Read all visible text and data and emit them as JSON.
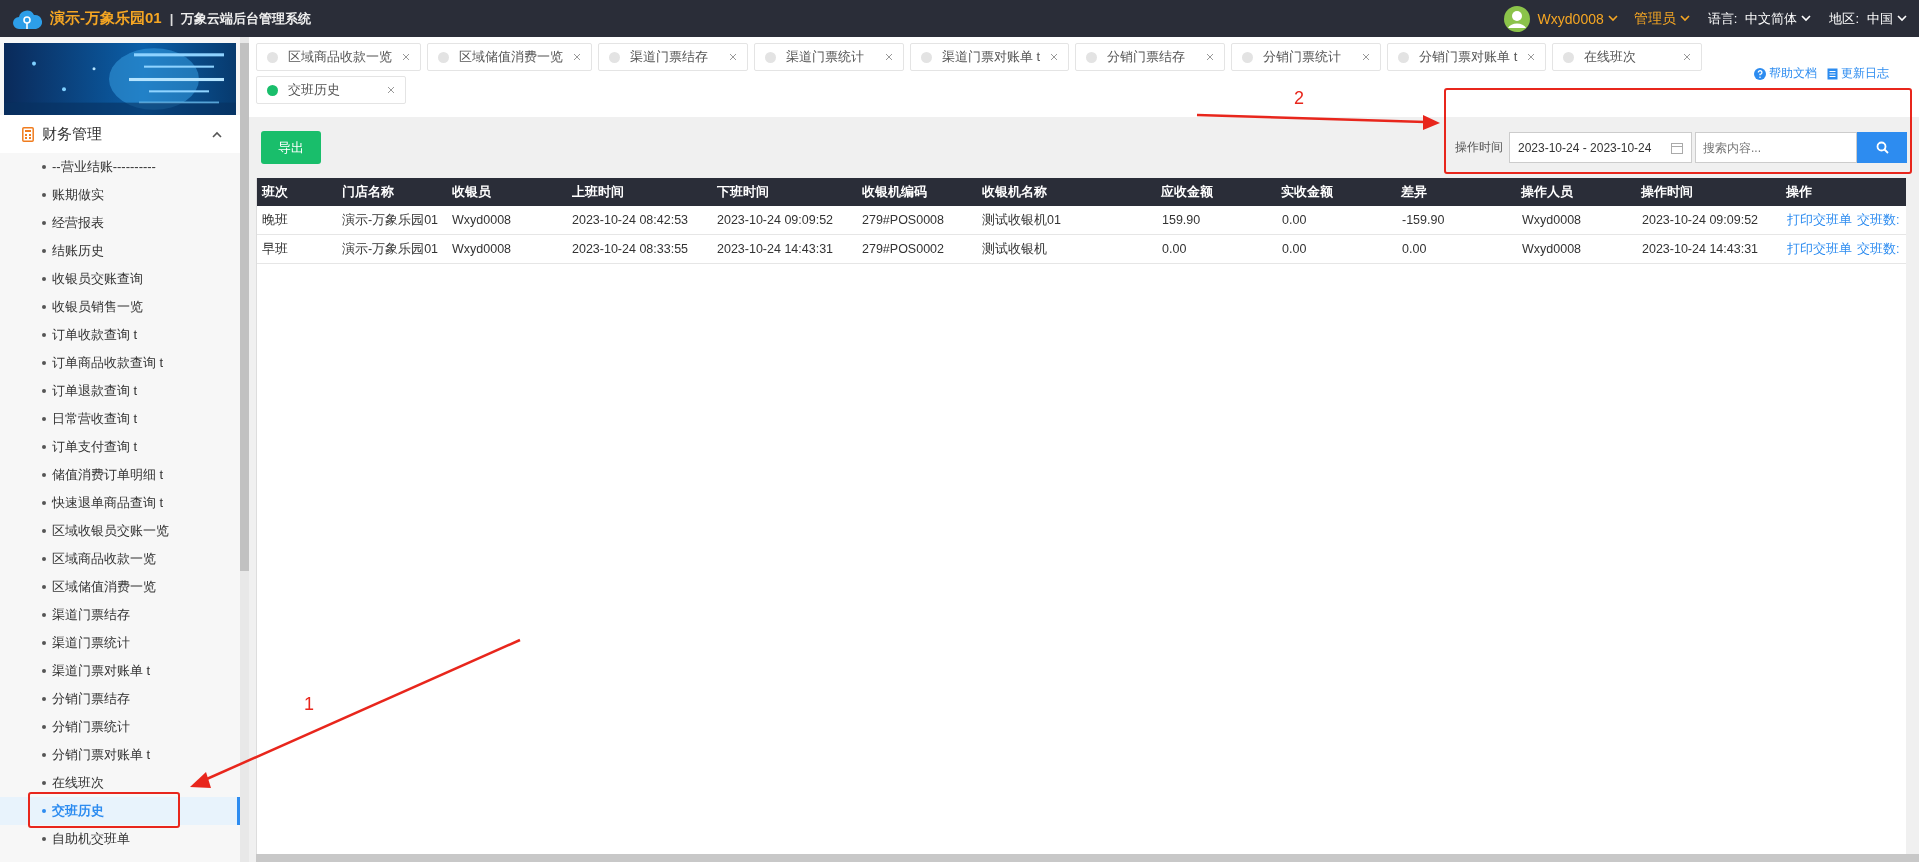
{
  "header": {
    "brand": "演示-万象乐园01",
    "separator": "|",
    "system": "万象云端后台管理系统",
    "user": "Wxyd0008",
    "role": "管理员",
    "language_label": "语言:",
    "language": "中文简体",
    "region_label": "地区:",
    "region": "中国"
  },
  "sidebar": {
    "group": {
      "label": "财务管理",
      "expanded": true
    },
    "items": [
      {
        "label": "--营业结账----------",
        "selected": false
      },
      {
        "label": "账期做实",
        "selected": false
      },
      {
        "label": "经营报表",
        "selected": false
      },
      {
        "label": "结账历史",
        "selected": false
      },
      {
        "label": "收银员交账查询",
        "selected": false
      },
      {
        "label": "收银员销售一览",
        "selected": false
      },
      {
        "label": "订单收款查询 t",
        "selected": false
      },
      {
        "label": "订单商品收款查询 t",
        "selected": false
      },
      {
        "label": "订单退款查询 t",
        "selected": false
      },
      {
        "label": "日常营收查询 t",
        "selected": false
      },
      {
        "label": "订单支付查询 t",
        "selected": false
      },
      {
        "label": "储值消费订单明细 t",
        "selected": false
      },
      {
        "label": "快速退单商品查询 t",
        "selected": false
      },
      {
        "label": "区域收银员交账一览",
        "selected": false
      },
      {
        "label": "区域商品收款一览",
        "selected": false
      },
      {
        "label": "区域储值消费一览",
        "selected": false
      },
      {
        "label": "渠道门票结存",
        "selected": false
      },
      {
        "label": "渠道门票统计",
        "selected": false
      },
      {
        "label": "渠道门票对账单 t",
        "selected": false
      },
      {
        "label": "分销门票结存",
        "selected": false
      },
      {
        "label": "分销门票统计",
        "selected": false
      },
      {
        "label": "分销门票对账单 t",
        "selected": false
      },
      {
        "label": "在线班次",
        "selected": false
      },
      {
        "label": "交班历史",
        "selected": true
      },
      {
        "label": "自助机交班单",
        "selected": false
      }
    ]
  },
  "tabs": [
    {
      "label": "区域商品收款一览",
      "selected": false
    },
    {
      "label": "区域储值消费一览",
      "selected": false
    },
    {
      "label": "渠道门票结存",
      "selected": false
    },
    {
      "label": "渠道门票统计",
      "selected": false
    },
    {
      "label": "渠道门票对账单 t",
      "selected": false
    },
    {
      "label": "分销门票结存",
      "selected": false
    },
    {
      "label": "分销门票统计",
      "selected": false
    },
    {
      "label": "分销门票对账单 t",
      "selected": false
    },
    {
      "label": "在线班次",
      "selected": false
    },
    {
      "label": "交班历史",
      "selected": true
    }
  ],
  "help_links": [
    "帮助文档",
    "更新日志"
  ],
  "toolbar": {
    "export_button": "导出",
    "filter_label": "操作时间",
    "date_range": "2023-10-24 - 2023-10-24",
    "search_placeholder": "搜索内容..."
  },
  "table": {
    "columns": [
      "班次",
      "门店名称",
      "收银员",
      "上班时间",
      "下班时间",
      "收银机编码",
      "收银机名称",
      "应收金额",
      "实收金额",
      "差异",
      "操作人员",
      "操作时间",
      "操作"
    ],
    "rows": [
      {
        "cells": [
          "晚班",
          "演示-万象乐园01",
          "Wxyd0008",
          "2023-10-24 08:42:53",
          "2023-10-24 09:09:52",
          "279#POS0008",
          "测试收银机01",
          "159.90",
          "0.00",
          "-159.90",
          "Wxyd0008",
          "2023-10-24 09:09:52"
        ],
        "actions": [
          "打印交班单",
          "交班数:"
        ]
      },
      {
        "cells": [
          "早班",
          "演示-万象乐园01",
          "Wxyd0008",
          "2023-10-24 08:33:55",
          "2023-10-24 14:43:31",
          "279#POS0002",
          "测试收银机",
          "0.00",
          "0.00",
          "0.00",
          "Wxyd0008",
          "2023-10-24 14:43:31"
        ],
        "actions": [
          "打印交班单",
          "交班数:"
        ]
      }
    ]
  },
  "annotations": [
    {
      "label": "1"
    },
    {
      "label": "2"
    }
  ]
}
